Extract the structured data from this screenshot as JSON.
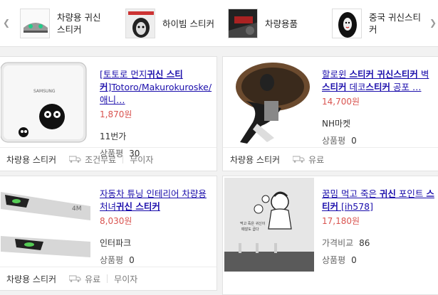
{
  "related": [
    {
      "label": "차량용 귀신\n스티커",
      "icon": "car-sticker-thumb"
    },
    {
      "label": "하이빔 스티커",
      "icon": "ghost-face-thumb"
    },
    {
      "label": "차량용품",
      "icon": "car-interior-thumb"
    },
    {
      "label": "중국 귀신스티\n커",
      "icon": "ghost-woman-thumb"
    }
  ],
  "cards": [
    {
      "title_parts": [
        "[토토로 먼지",
        "귀신 스티커",
        "]Totoro/Makurokuroske/애니…"
      ],
      "price": "1,870원",
      "seller": "11번가",
      "rating_label": "상품평",
      "rating_value": "30",
      "category": "차량용 스티커",
      "shipping": "조건무료",
      "interest": "무이자"
    },
    {
      "title_parts": [
        "할로윈 ",
        "스티커 귀신스티커",
        " 벽 ",
        "스티커",
        " 데코",
        "스티커",
        " 공포 …"
      ],
      "price": "14,700원",
      "seller": "NH마켓",
      "rating_label": "상품평",
      "rating_value": "0",
      "category": "차량용 스티커",
      "shipping": "유료"
    },
    {
      "title_parts": [
        "자동차 튜닝 인테리어 차량용 처녀",
        "귀신 스티커",
        ""
      ],
      "price": "8,030원",
      "seller": "인터파크",
      "rating_label": "상품평",
      "rating_value": "0",
      "category": "차량용 스티커",
      "shipping": "유료",
      "interest": "무이자"
    },
    {
      "title_parts": [
        "꿈밈 먹고 죽은 ",
        "귀신",
        " 포인트 ",
        "스티커",
        " [ih578]"
      ],
      "price": "17,180원",
      "seller_label": "가격비교",
      "seller_value": "86",
      "rating_label": "상품평",
      "rating_value": "0"
    }
  ]
}
